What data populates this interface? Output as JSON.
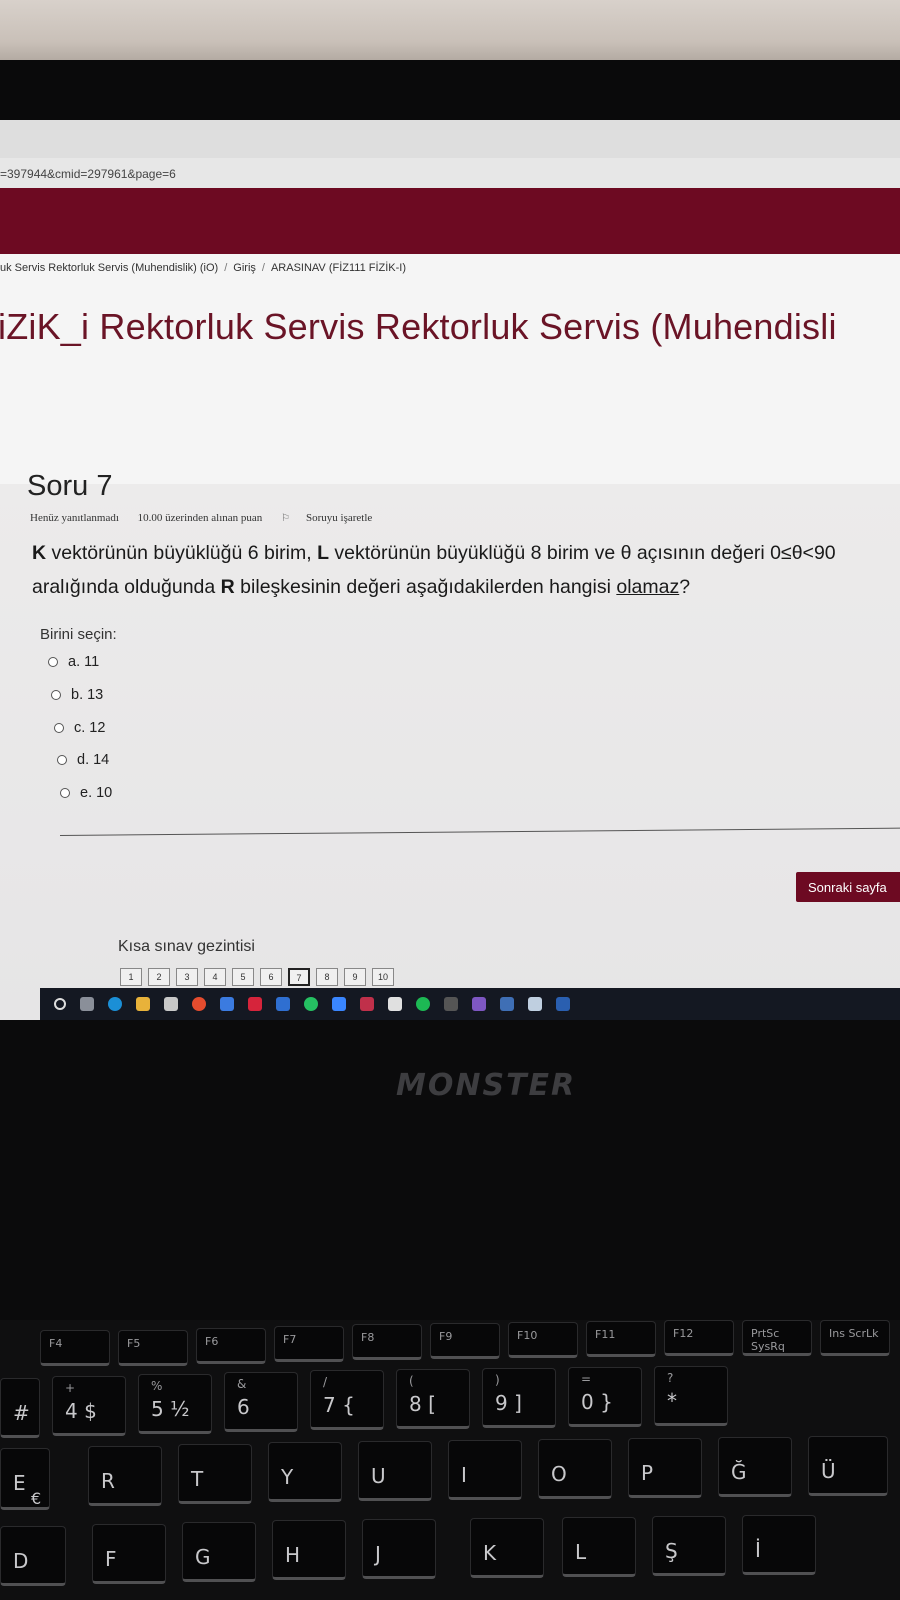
{
  "browser": {
    "url": "=397944&cmid=297961&page=6"
  },
  "breadcrumb": {
    "course": "uk Servis Rektorluk Servis (Muhendislik) (iO)",
    "sep": "/",
    "home": "Giriş",
    "quiz": "ARASINAV (FİZ111 FİZİK-I)"
  },
  "page": {
    "title": "iZiK_i Rektorluk Servis Rektorluk Servis (Muhendisli"
  },
  "question": {
    "heading": "Soru 7",
    "status": "Henüz yanıtlanmadı",
    "points": "10.00 üzerinden alınan puan",
    "flag": "Soruyu işaretle",
    "text_parts": [
      "K",
      " vektörünün büyüklüğü 6 birim, ",
      "L",
      " vektörünün büyüklüğü 8 birim ve θ açısının değeri 0≤θ<90 aralığında olduğunda ",
      "R",
      " bileşkesinin değeri aşağıdakilerden hangisi ",
      "olamaz",
      "?"
    ],
    "choose_label": "Birini seçin:",
    "options": [
      "a. 11",
      "b. 13",
      "c. 12",
      "d. 14",
      "e. 10"
    ]
  },
  "next_button": "Sonraki sayfa",
  "quiz_nav": {
    "title": "Kısa sınav gezintisi",
    "pages": [
      "1",
      "2",
      "3",
      "4",
      "5",
      "6",
      "7",
      "8",
      "9",
      "10"
    ],
    "current": "7"
  },
  "laptop": {
    "brand": "MONSTER"
  },
  "keyboard": {
    "fkeys": [
      "F4",
      "F5",
      "F6",
      "F7",
      "F8",
      "F9",
      "F10",
      "F11",
      "F12",
      "PrtSc SysRq",
      "Ins ScrLk"
    ],
    "number_row": [
      {
        "main": "4 $",
        "sub": "+"
      },
      {
        "main": "5 ½",
        "sub": "%"
      },
      {
        "main": "6",
        "sub": "&"
      },
      {
        "main": "7 {",
        "sub": "/"
      },
      {
        "main": "8 [",
        "sub": "("
      },
      {
        "main": "9 ]",
        "sub": ")"
      },
      {
        "main": "0 }",
        "sub": "="
      },
      {
        "main": "*",
        "sub": "?"
      }
    ],
    "row_q": [
      "E",
      "R",
      "T",
      "Y",
      "U",
      "I",
      "O",
      "P",
      "Ğ",
      "Ü"
    ],
    "row_a": [
      "D",
      "F",
      "G",
      "H",
      "J",
      "K",
      "L",
      "Ş",
      "İ"
    ],
    "euro": "€",
    "hash": "#"
  },
  "colors": {
    "brand_maroon": "#6d0a22",
    "title_maroon": "#6a1426"
  }
}
